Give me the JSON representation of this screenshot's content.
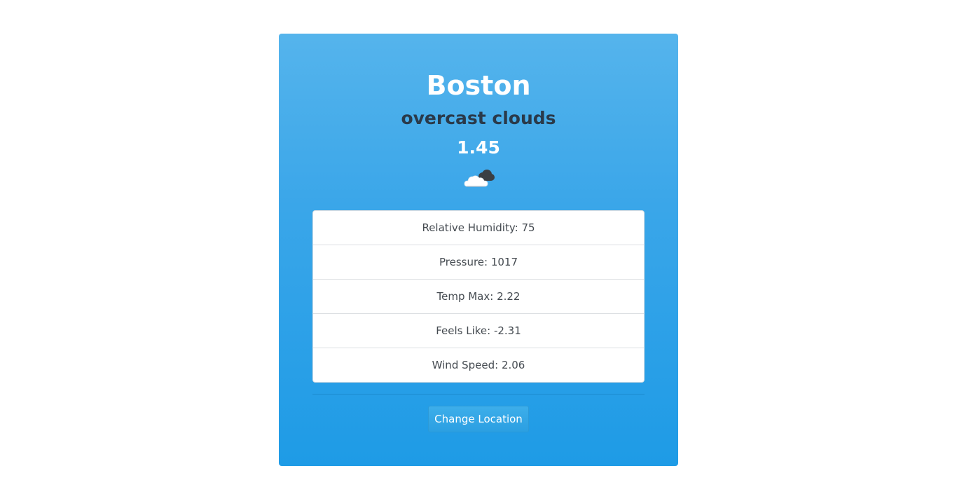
{
  "weather": {
    "city": "Boston",
    "description": "overcast clouds",
    "temperature": "1.45",
    "icon": "overcast-clouds-icon"
  },
  "details": [
    {
      "label": "Relative Humidity: 75"
    },
    {
      "label": "Pressure: 1017"
    },
    {
      "label": "Temp Max: 2.22"
    },
    {
      "label": "Feels Like: -2.31"
    },
    {
      "label": "Wind Speed: 2.06"
    }
  ],
  "actions": {
    "change_location_label": "Change Location"
  },
  "colors": {
    "card_top": "#55b4ec",
    "card_bottom": "#1e9be6",
    "description_text": "#2a3a4a"
  }
}
